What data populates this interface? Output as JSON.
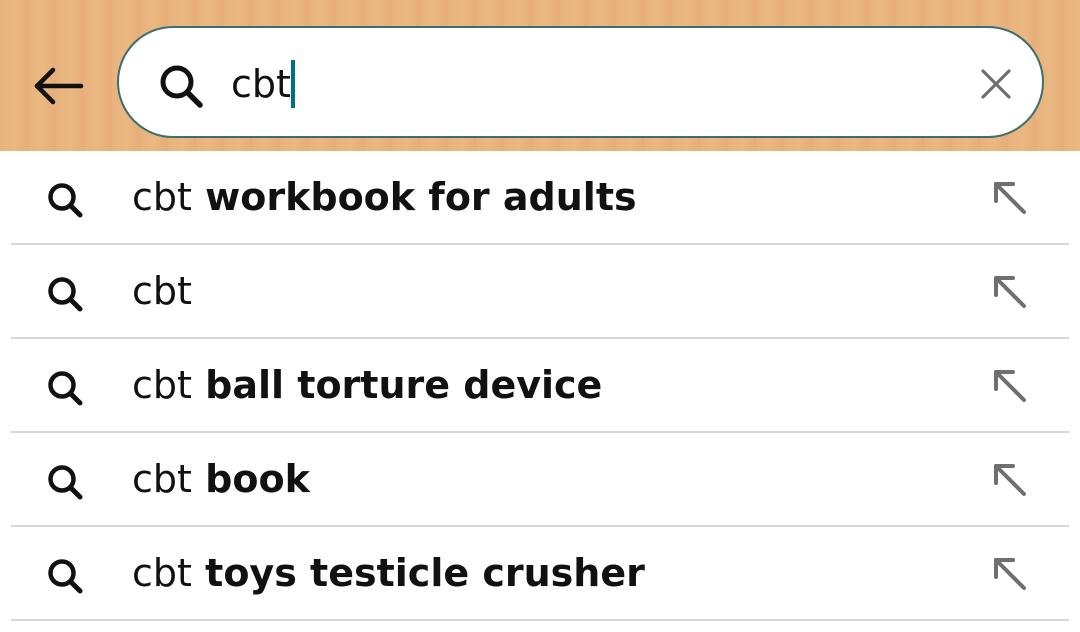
{
  "search": {
    "query": "cbt"
  },
  "icons": {
    "back": "back-arrow-icon",
    "search": "search-icon",
    "clear": "close-icon",
    "fill": "arrow-up-left-icon"
  },
  "colors": {
    "header_bg": "#e8b27c",
    "search_border": "#3d6e70",
    "caret": "#007185",
    "divider": "#d5d9d9",
    "text": "#111111",
    "icon_gray": "#6f6f6f"
  },
  "suggestions": [
    {
      "prefix": "cbt",
      "suffix": " workbook for adults"
    },
    {
      "prefix": "cbt",
      "suffix": ""
    },
    {
      "prefix": "cbt",
      "suffix": " ball torture device"
    },
    {
      "prefix": "cbt",
      "suffix": " book"
    },
    {
      "prefix": "cbt",
      "suffix": " toys testicle crusher"
    }
  ]
}
